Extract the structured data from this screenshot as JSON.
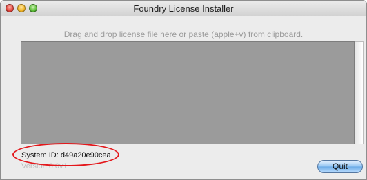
{
  "window": {
    "title": "Foundry License Installer"
  },
  "main": {
    "instructions": "Drag and drop license file here or paste (apple+v) from clipboard.",
    "system_id": "System ID: d49a20e90cea",
    "version": "Version 6.0v1"
  },
  "buttons": {
    "quit_label": "Quit"
  },
  "colors": {
    "drop_area": "#9b9b9b",
    "highlight": "#e4171b",
    "quit_button": "#8fc2f1"
  }
}
